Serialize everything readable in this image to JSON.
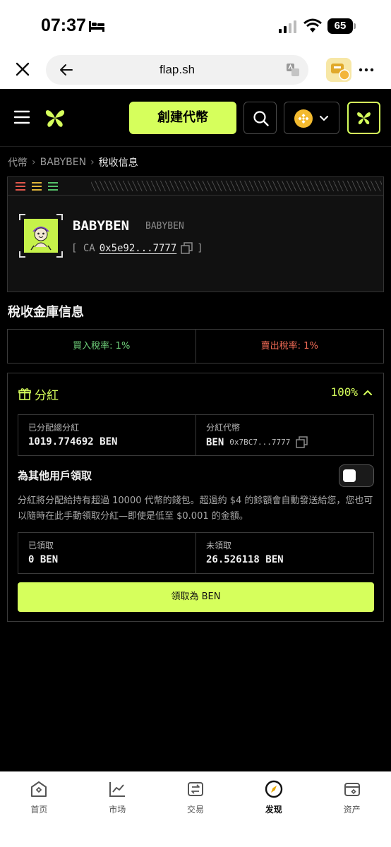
{
  "status_bar": {
    "time": "07:37",
    "battery": "65"
  },
  "browser": {
    "url": "flap.sh"
  },
  "header": {
    "create_label": "創建代幣"
  },
  "breadcrumb": {
    "items": [
      "代幣",
      "BABYBEN",
      "稅收信息"
    ]
  },
  "token": {
    "name": "BABYBEN",
    "symbol": "BABYBEN",
    "ca_prefix": "[ CA",
    "ca_address": "0x5e92...7777",
    "ca_suffix": "]"
  },
  "tax": {
    "section_title": "稅收金庫信息",
    "buy": "買入稅率: 1%",
    "sell": "賣出稅率: 1%"
  },
  "dividend": {
    "title": "分紅",
    "percent": "100%",
    "distributed_label": "已分配總分紅",
    "distributed_value": "1019.774692 BEN",
    "token_label": "分紅代幣",
    "token_symbol": "BEN",
    "token_address": "0x7BC7...7777",
    "claim_others_label": "為其他用戶領取",
    "description": "分紅將分配給持有超過 10000 代幣的錢包。超過約 $4 的餘額會自動發送給您，您也可以隨時在此手動領取分紅—即使是低至 $0.001 的金額。",
    "claimed_label": "已領取",
    "claimed_value": "0 BEN",
    "unclaimed_label": "未領取",
    "unclaimed_value": "26.526118 BEN",
    "claim_button": "領取為 BEN"
  },
  "nav": {
    "items": [
      {
        "label": "首页",
        "icon": "home-icon"
      },
      {
        "label": "市场",
        "icon": "market-chart-icon"
      },
      {
        "label": "交易",
        "icon": "swap-icon"
      },
      {
        "label": "发现",
        "icon": "discover-compass-icon"
      },
      {
        "label": "资产",
        "icon": "wallet-icon"
      }
    ]
  },
  "colors": {
    "accent": "#d6ff5c",
    "buy": "#6fd07a",
    "sell": "#f06a55",
    "bnb": "#f3ba2f"
  }
}
